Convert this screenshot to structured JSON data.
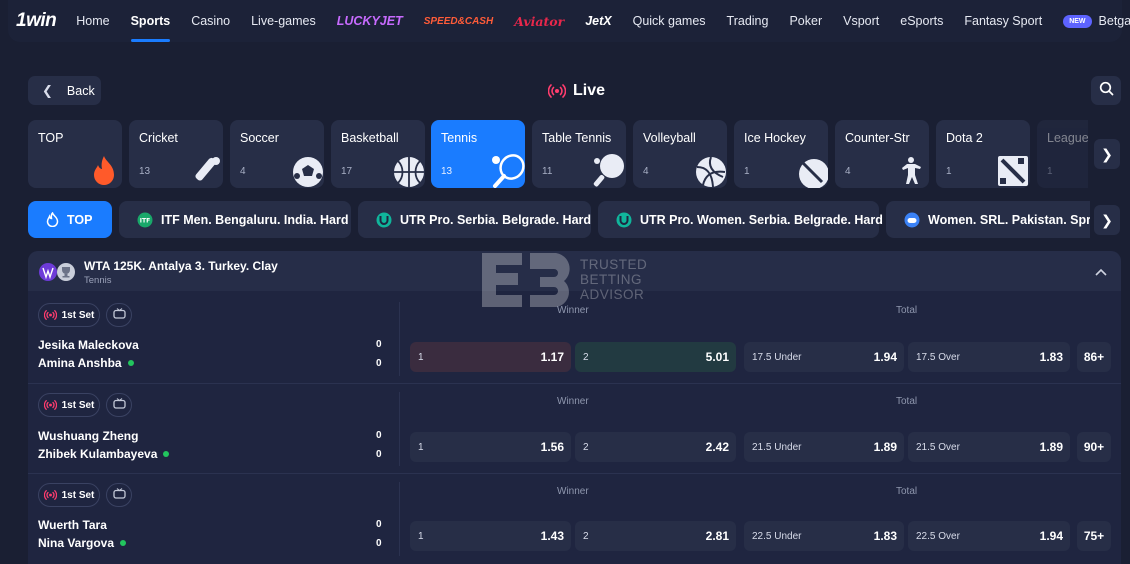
{
  "nav": {
    "logo_one": "1",
    "logo_win": "win",
    "items": [
      {
        "label": "Home"
      },
      {
        "label": "Sports",
        "active": true
      },
      {
        "label": "Casino"
      },
      {
        "label": "Live-games"
      }
    ],
    "brands": [
      {
        "label": "LUCKYJET",
        "color": "#c86bff"
      },
      {
        "label": "SPEED&CASH",
        "color": "#ff5c39"
      },
      {
        "label": "Aviator",
        "color": "#e8274b"
      },
      {
        "label": "JetX",
        "color": "#ffffff"
      }
    ],
    "items2": [
      {
        "label": "Quick games"
      },
      {
        "label": "Trading"
      },
      {
        "label": "Poker"
      },
      {
        "label": "Vsport"
      },
      {
        "label": "eSports"
      },
      {
        "label": "Fantasy Sport"
      }
    ],
    "new_badge": "NEW",
    "betgames": "Betgames"
  },
  "header": {
    "back_label": "Back",
    "title": "Live"
  },
  "sports": [
    {
      "name": "TOP",
      "count": "",
      "icon": "flame-icon"
    },
    {
      "name": "Cricket",
      "count": "13",
      "icon": "cricket-icon"
    },
    {
      "name": "Soccer",
      "count": "4",
      "icon": "soccer-ball-icon"
    },
    {
      "name": "Basketball",
      "count": "17",
      "icon": "basketball-icon"
    },
    {
      "name": "Tennis",
      "count": "13",
      "icon": "tennis-icon",
      "active": true
    },
    {
      "name": "Table Tennis",
      "count": "11",
      "icon": "table-tennis-icon"
    },
    {
      "name": "Volleyball",
      "count": "4",
      "icon": "volleyball-icon"
    },
    {
      "name": "Ice Hockey",
      "count": "1",
      "icon": "ice-hockey-icon"
    },
    {
      "name": "Counter-Str",
      "count": "4",
      "icon": "counter-strike-icon"
    },
    {
      "name": "Dota 2",
      "count": "1",
      "icon": "dota-icon"
    },
    {
      "name": "League",
      "count": "1",
      "icon": "league-icon"
    }
  ],
  "chips": [
    {
      "label": "TOP"
    },
    {
      "label": "ITF Men. Bengaluru. India. Hard"
    },
    {
      "label": "UTR Pro. Serbia. Belgrade. Hard"
    },
    {
      "label": "UTR Pro. Women. Serbia. Belgrade. Hard"
    },
    {
      "label": "Women. SRL. Pakistan. Sprin"
    }
  ],
  "league": {
    "name": "WTA 125K. Antalya 3. Turkey. Clay",
    "sport": "Tennis"
  },
  "watermark": {
    "line1": "TRUSTED",
    "line2": "BETTING",
    "line3": "ADVISOR"
  },
  "market_labels": {
    "winner": "Winner",
    "total": "Total"
  },
  "matches": [
    {
      "set": "1st Set",
      "team1": "Jesika Maleckova",
      "score1": "0",
      "team2": "Amina Anshba",
      "score2": "0",
      "w1_label": "1",
      "w1": "1.17",
      "w2_label": "2",
      "w2": "5.01",
      "under_label": "17.5 Under",
      "under": "1.94",
      "over_label": "17.5 Over",
      "over": "1.83",
      "more": "86+"
    },
    {
      "set": "1st Set",
      "team1": "Wushuang Zheng",
      "score1": "0",
      "team2": "Zhibek Kulambayeva",
      "score2": "0",
      "w1_label": "1",
      "w1": "1.56",
      "w2_label": "2",
      "w2": "2.42",
      "under_label": "21.5 Under",
      "under": "1.89",
      "over_label": "21.5 Over",
      "over": "1.89",
      "more": "90+"
    },
    {
      "set": "1st Set",
      "team1": "Wuerth Tara",
      "score1": "0",
      "team2": "Nina Vargova",
      "score2": "0",
      "w1_label": "1",
      "w1": "1.43",
      "w2_label": "2",
      "w2": "2.81",
      "under_label": "22.5 Under",
      "under": "1.83",
      "over_label": "22.5 Over",
      "over": "1.94",
      "more": "75+"
    }
  ]
}
